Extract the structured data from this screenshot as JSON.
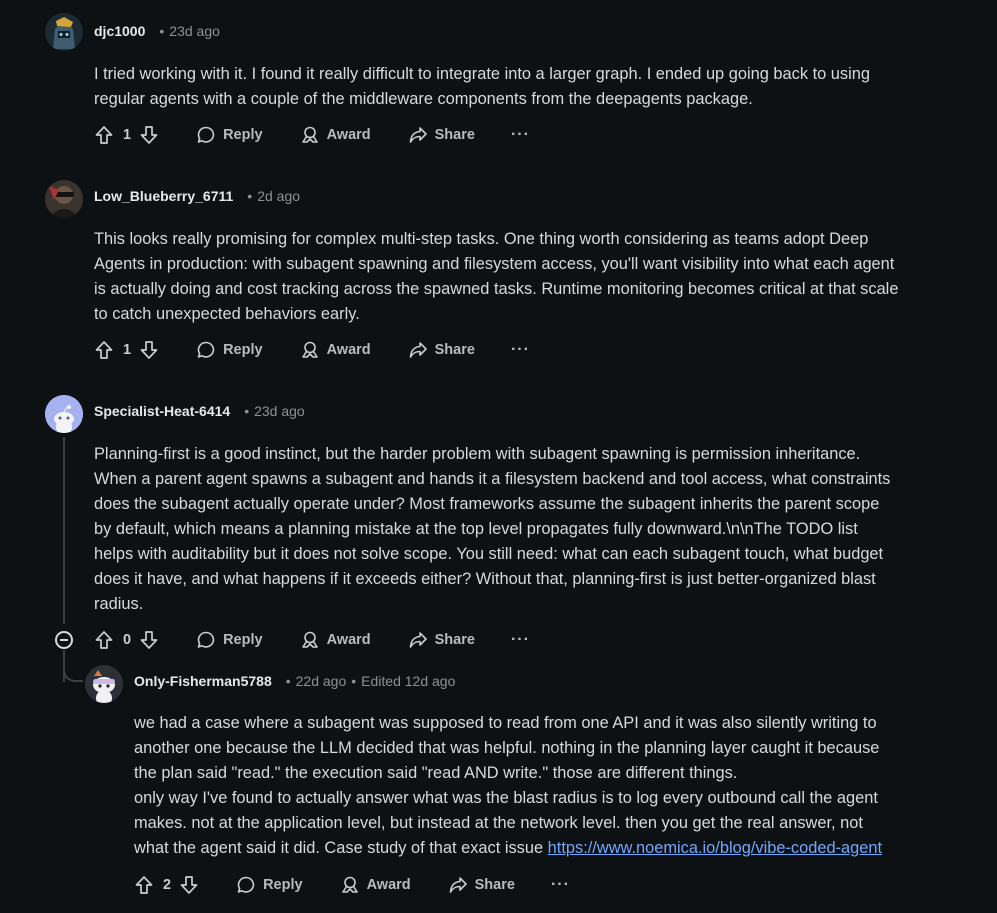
{
  "comments": [
    {
      "user": "djc1000",
      "time": "23d ago",
      "body": [
        "I tried working with it. I found it really difficult to integrate into a larger graph. I ended up going back to using",
        "regular agents with a couple of the middleware components from the deepagents package."
      ],
      "votes": "1",
      "reply": "Reply",
      "award": "Award",
      "share": "Share",
      "more": "···"
    },
    {
      "user": "Low_Blueberry_6711",
      "time": "2d ago",
      "body": [
        "This looks really promising for complex multi-step tasks. One thing worth considering as teams adopt Deep",
        "Agents in production: with subagent spawning and filesystem access, you'll want visibility into what each agent",
        "is actually doing and cost tracking across the spawned tasks. Runtime monitoring becomes critical at that scale",
        "to catch unexpected behaviors early."
      ],
      "votes": "1",
      "reply": "Reply",
      "award": "Award",
      "share": "Share",
      "more": "···"
    },
    {
      "user": "Specialist-Heat-6414",
      "time": "23d ago",
      "body": [
        "Planning-first is a good instinct, but the harder problem with subagent spawning is permission inheritance.",
        "When a parent agent spawns a subagent and hands it a filesystem backend and tool access, what constraints",
        "does the subagent actually operate under? Most frameworks assume the subagent inherits the parent scope",
        "by default, which means a planning mistake at the top level propagates fully downward.\\n\\nThe TODO list",
        "helps with auditability but it does not solve scope. You still need: what can each subagent touch, what budget",
        "does it have, and what happens if it exceeds either? Without that, planning-first is just better-organized blast",
        "radius."
      ],
      "votes": "0",
      "reply": "Reply",
      "award": "Award",
      "share": "Share",
      "more": "···"
    },
    {
      "user": "Only-Fisherman5788",
      "time": "22d ago",
      "edited": "Edited 12d ago",
      "body": [
        "we had a case where a subagent was supposed to read from one API and it was also silently writing to",
        "another one because the LLM decided that was helpful. nothing in the planning layer caught it because",
        "the plan said \"read.\" the execution said \"read AND write.\" those are different things.",
        "only way I've found to actually answer what was the blast radius is to log every outbound call the agent",
        "makes. not at the application level, but instead at the network level. then you get the real answer, not"
      ],
      "last_line_prefix": "what the agent said it did. Case study of that exact issue ",
      "link": "https://www.noemica.io/blog/vibe-coded-agent",
      "votes": "2",
      "reply": "Reply",
      "award": "Award",
      "share": "Share",
      "more": "···"
    }
  ],
  "colors": {
    "background": "#0e1113",
    "link": "#6ea8ff",
    "muted": "#8a9295"
  }
}
